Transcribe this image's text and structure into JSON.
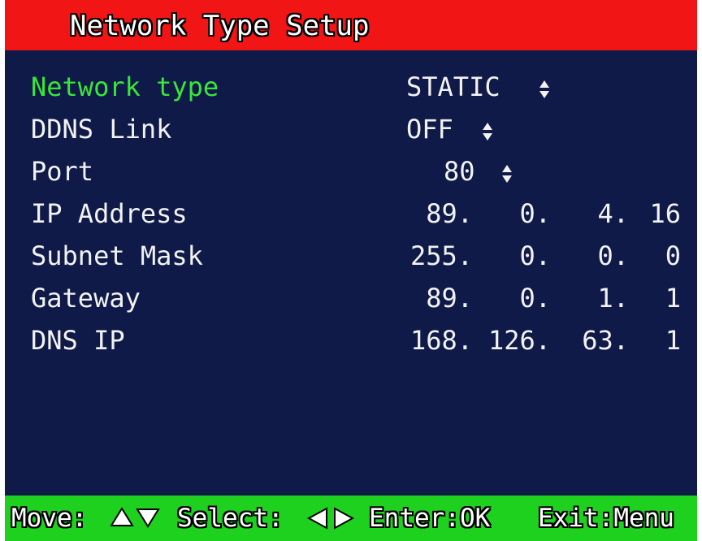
{
  "title": "Network Type Setup",
  "fields": {
    "network_type": {
      "label": "Network type",
      "value": "STATIC"
    },
    "ddns_link": {
      "label": "DDNS Link",
      "value": "OFF"
    },
    "port": {
      "label": "Port",
      "value": "80"
    },
    "ip_address": {
      "label": "IP Address",
      "octets": [
        "89.",
        "0.",
        "4.",
        "16"
      ]
    },
    "subnet_mask": {
      "label": "Subnet Mask",
      "octets": [
        "255.",
        "0.",
        "0.",
        "0"
      ]
    },
    "gateway": {
      "label": "Gateway",
      "octets": [
        "89.",
        "0.",
        "1.",
        "1"
      ]
    },
    "dns_ip": {
      "label": "DNS IP",
      "octets": [
        "168.",
        "126.",
        "63.",
        "1"
      ]
    }
  },
  "footer": {
    "move_label": "Move:",
    "select_label": "Select:",
    "enter_label": "Enter:OK",
    "exit_label": "Exit:Menu",
    "move_icon": "up-down-triangles",
    "select_icon": "left-right-triangles"
  },
  "colors": {
    "title_bar": "#f21515",
    "background": "#0f1a48",
    "active_label": "#39e639",
    "footer_bar": "#1fd11f",
    "text": "#f2f2f2"
  }
}
